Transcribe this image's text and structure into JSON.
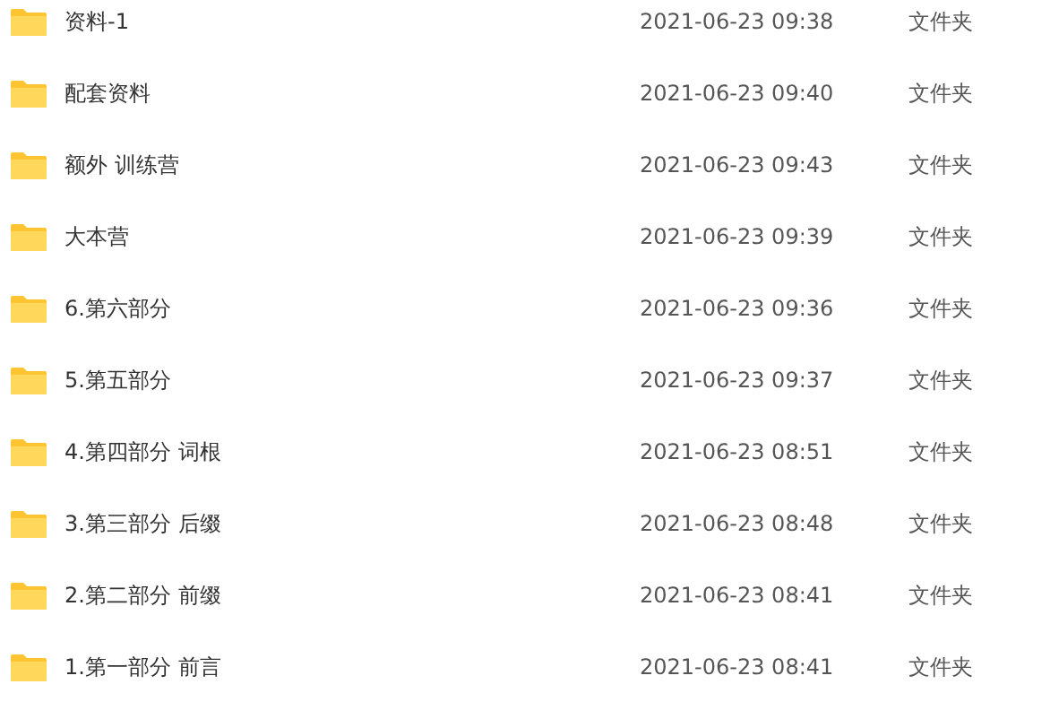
{
  "files": [
    {
      "name": "资料-1",
      "modified": "2021-06-23 09:38",
      "type": "文件夹"
    },
    {
      "name": "配套资料",
      "modified": "2021-06-23 09:40",
      "type": "文件夹"
    },
    {
      "name": "额外 训练营",
      "modified": "2021-06-23 09:43",
      "type": "文件夹"
    },
    {
      "name": "大本营",
      "modified": "2021-06-23 09:39",
      "type": "文件夹"
    },
    {
      "name": "6.第六部分",
      "modified": "2021-06-23 09:36",
      "type": "文件夹"
    },
    {
      "name": "5.第五部分",
      "modified": "2021-06-23 09:37",
      "type": "文件夹"
    },
    {
      "name": "4.第四部分 词根",
      "modified": "2021-06-23 08:51",
      "type": "文件夹"
    },
    {
      "name": "3.第三部分 后缀",
      "modified": "2021-06-23 08:48",
      "type": "文件夹"
    },
    {
      "name": "2.第二部分 前缀",
      "modified": "2021-06-23 08:41",
      "type": "文件夹"
    },
    {
      "name": "1.第一部分 前言",
      "modified": "2021-06-23 08:41",
      "type": "文件夹"
    }
  ]
}
